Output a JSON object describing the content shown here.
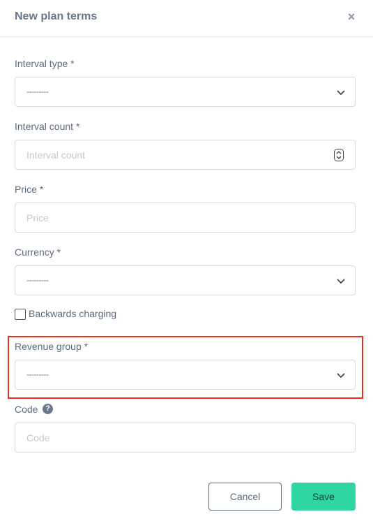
{
  "modal": {
    "title": "New plan terms",
    "close_glyph": "×"
  },
  "fields": {
    "interval_type": {
      "label": "Interval type *",
      "value": "---------"
    },
    "interval_count": {
      "label": "Interval count *",
      "placeholder": "Interval count"
    },
    "price": {
      "label": "Price *",
      "placeholder": "Price"
    },
    "currency": {
      "label": "Currency *",
      "value": "---------"
    },
    "backwards_charging": {
      "label": "Backwards charging",
      "checked": false
    },
    "revenue_group": {
      "label": "Revenue group *",
      "value": "---------"
    },
    "code": {
      "label": "Code",
      "placeholder": "Code",
      "help_glyph": "?"
    }
  },
  "buttons": {
    "cancel": "Cancel",
    "save": "Save"
  },
  "colors": {
    "highlight": "#e8301c",
    "save_bg": "#2fd6a1"
  }
}
